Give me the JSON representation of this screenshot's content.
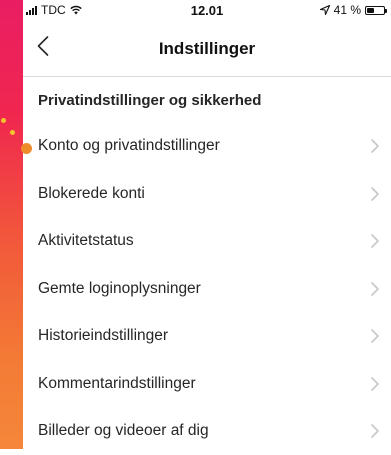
{
  "status_bar": {
    "carrier": "TDC",
    "time": "12.01",
    "battery_label": "41 %",
    "battery_level": 0.41
  },
  "nav": {
    "title": "Indstillinger",
    "back_icon": "chevron-left-icon"
  },
  "section": {
    "header": "Privatindstillinger og sikkerhed",
    "items": [
      {
        "label": "Konto og privatindstillinger",
        "name": "account-privacy"
      },
      {
        "label": "Blokerede konti",
        "name": "blocked-accounts"
      },
      {
        "label": "Aktivitetstatus",
        "name": "activity-status"
      },
      {
        "label": "Gemte loginoplysninger",
        "name": "saved-login-info"
      },
      {
        "label": "Historieindstillinger",
        "name": "story-settings"
      },
      {
        "label": "Kommentarindstillinger",
        "name": "comment-settings"
      },
      {
        "label": "Billeder og videoer af dig",
        "name": "photos-videos-of-you"
      }
    ]
  },
  "colors": {
    "accent_edge_top": "#e91e63",
    "accent_edge_bottom": "#f5873a",
    "cursor_dot": "#ef8c2a",
    "text": "#262626",
    "chevron": "#c7c7cc"
  }
}
